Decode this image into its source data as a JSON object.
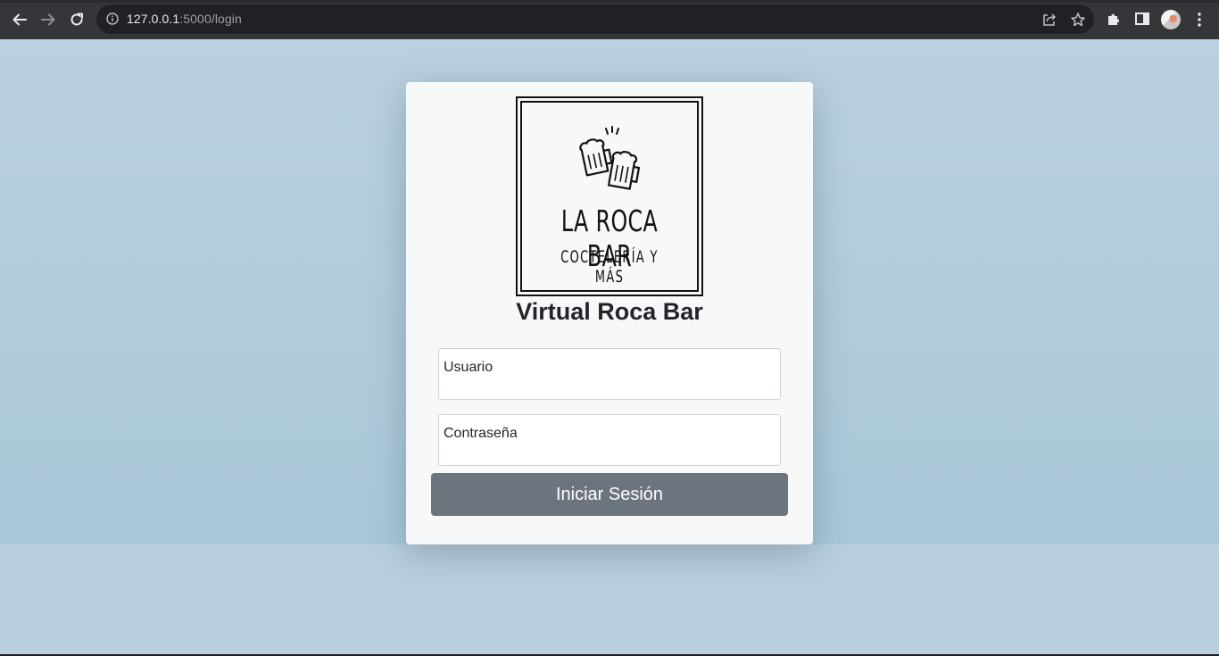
{
  "browser": {
    "url_host": "127.0.0.1",
    "url_path": ":5000/login"
  },
  "logo": {
    "brand": "LA ROCA BAR",
    "tagline": "COCTELERÍA Y MÁS"
  },
  "login": {
    "title": "Virtual Roca Bar",
    "username_label": "Usuario",
    "password_label": "Contraseña",
    "submit_label": "Iniciar Sesión"
  },
  "icons": {
    "back": "arrow-left-icon",
    "forward": "arrow-right-icon",
    "reload": "reload-icon",
    "site_info": "info-icon",
    "share": "share-icon",
    "bookmark": "star-icon",
    "extensions": "puzzle-icon",
    "side_panel": "side-panel-icon",
    "profile": "avatar",
    "menu": "kebab-menu-icon",
    "logo_art": "beer-mugs-icon"
  },
  "colors": {
    "button": "#6c757d",
    "card": "#f7f8f9",
    "page_background": "#b9d0de"
  }
}
